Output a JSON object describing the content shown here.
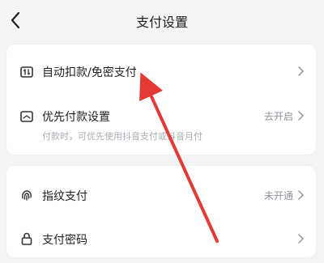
{
  "header": {
    "title": "支付设置",
    "back_icon": "chevron-left-icon"
  },
  "settings": {
    "card1": [
      {
        "label": "自动扣款/免密支付",
        "icon": "auto-deduct-icon"
      },
      {
        "label": "优先付款设置",
        "status": "去开启",
        "subtext": "付款时，可优先使用抖音支付或抖音月付",
        "icon": "priority-payment-icon"
      }
    ],
    "card2": [
      {
        "label": "指纹支付",
        "status": "未开通",
        "icon": "fingerprint-icon"
      },
      {
        "label": "支付密码",
        "icon": "lock-icon"
      }
    ]
  },
  "colors": {
    "background": "#f3f4f6",
    "card": "#ffffff",
    "annotation_arrow": "#e53935"
  }
}
